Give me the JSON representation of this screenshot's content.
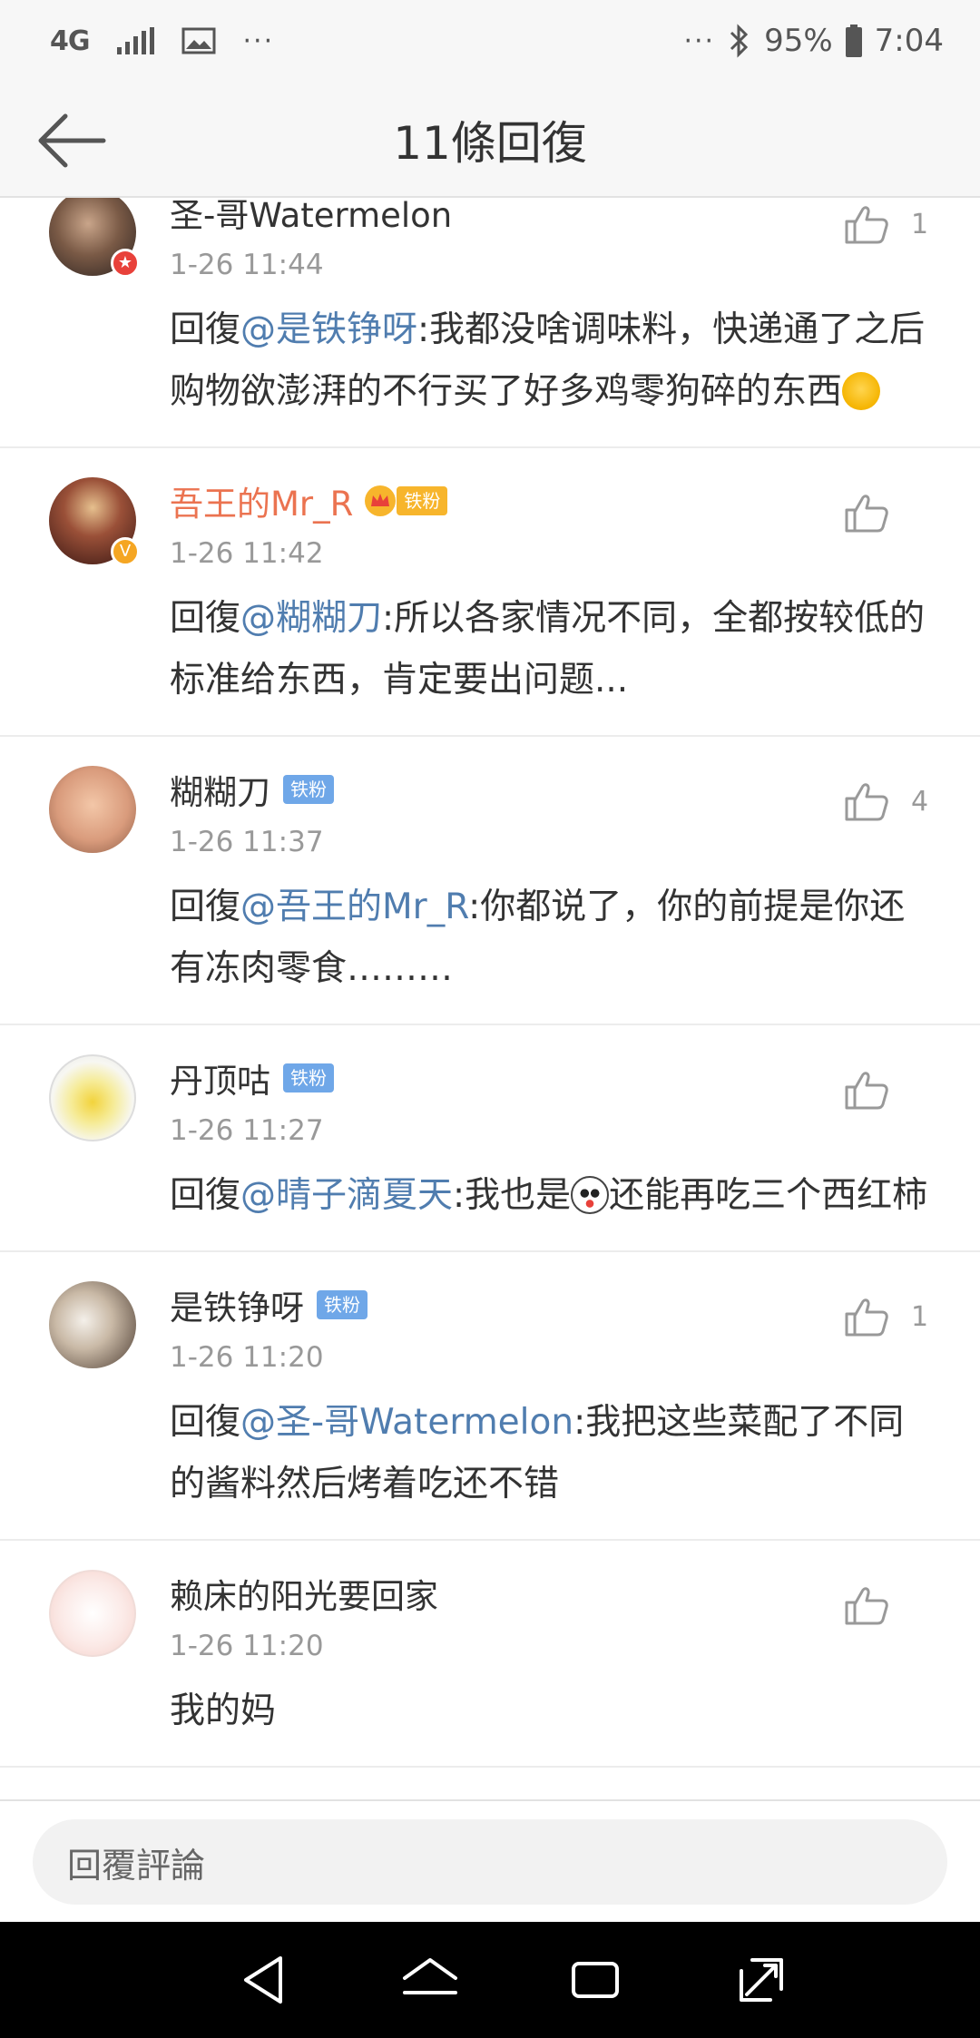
{
  "status_bar": {
    "network": "4G",
    "dots_left": "···",
    "dots_right": "···",
    "battery": "95%",
    "time": "7:04"
  },
  "header": {
    "title": "11條回復"
  },
  "comments": [
    {
      "username": "圣-哥Watermelon",
      "time": "1-26 11:44",
      "reply_prefix": "回復",
      "mention": "@是铁铮呀",
      "text": ":我都没啥调味料，快递通了之后购物欲澎湃的不行买了好多鸡零狗碎的东西",
      "emoji": "laughing-crying-emoji",
      "likes": "1"
    },
    {
      "username": "吾王的Mr_R",
      "badge": "铁粉",
      "time": "1-26 11:42",
      "reply_prefix": "回復",
      "mention": "@糊糊刀",
      "text": ":所以各家情况不同，全都按较低的标准给东西，肯定要出问题...",
      "likes": ""
    },
    {
      "username": "糊糊刀",
      "badge": "铁粉",
      "time": "1-26 11:37",
      "reply_prefix": "回復",
      "mention": "@吾王的Mr_R",
      "text": ":你都说了，你的前提是你还有冻肉零食………",
      "likes": "4"
    },
    {
      "username": "丹顶咕",
      "badge": "铁粉",
      "time": "1-26 11:27",
      "reply_prefix": "回復",
      "mention": "@晴子滴夏天",
      "text_before_emoji": ":我也是",
      "emoji": "panda-emoji",
      "text_after_emoji": "还能再吃三个西红柿",
      "likes": ""
    },
    {
      "username": "是铁铮呀",
      "badge": "铁粉",
      "time": "1-26 11:20",
      "reply_prefix": "回復",
      "mention": "@圣-哥Watermelon",
      "text": ":我把这些菜配了不同的酱料然后烤着吃还不错",
      "likes": "1"
    },
    {
      "username": "赖床的阳光要回家",
      "time": "1-26 11:20",
      "text": "我的妈",
      "likes": ""
    }
  ],
  "reply_input": {
    "placeholder": "回覆評論"
  },
  "colors": {
    "mention": "#507daf",
    "orange_username": "#eb7350",
    "fan_badge": "#6fa7e8",
    "gold_badge": "#f7b52c",
    "secondary_text": "#999999"
  }
}
